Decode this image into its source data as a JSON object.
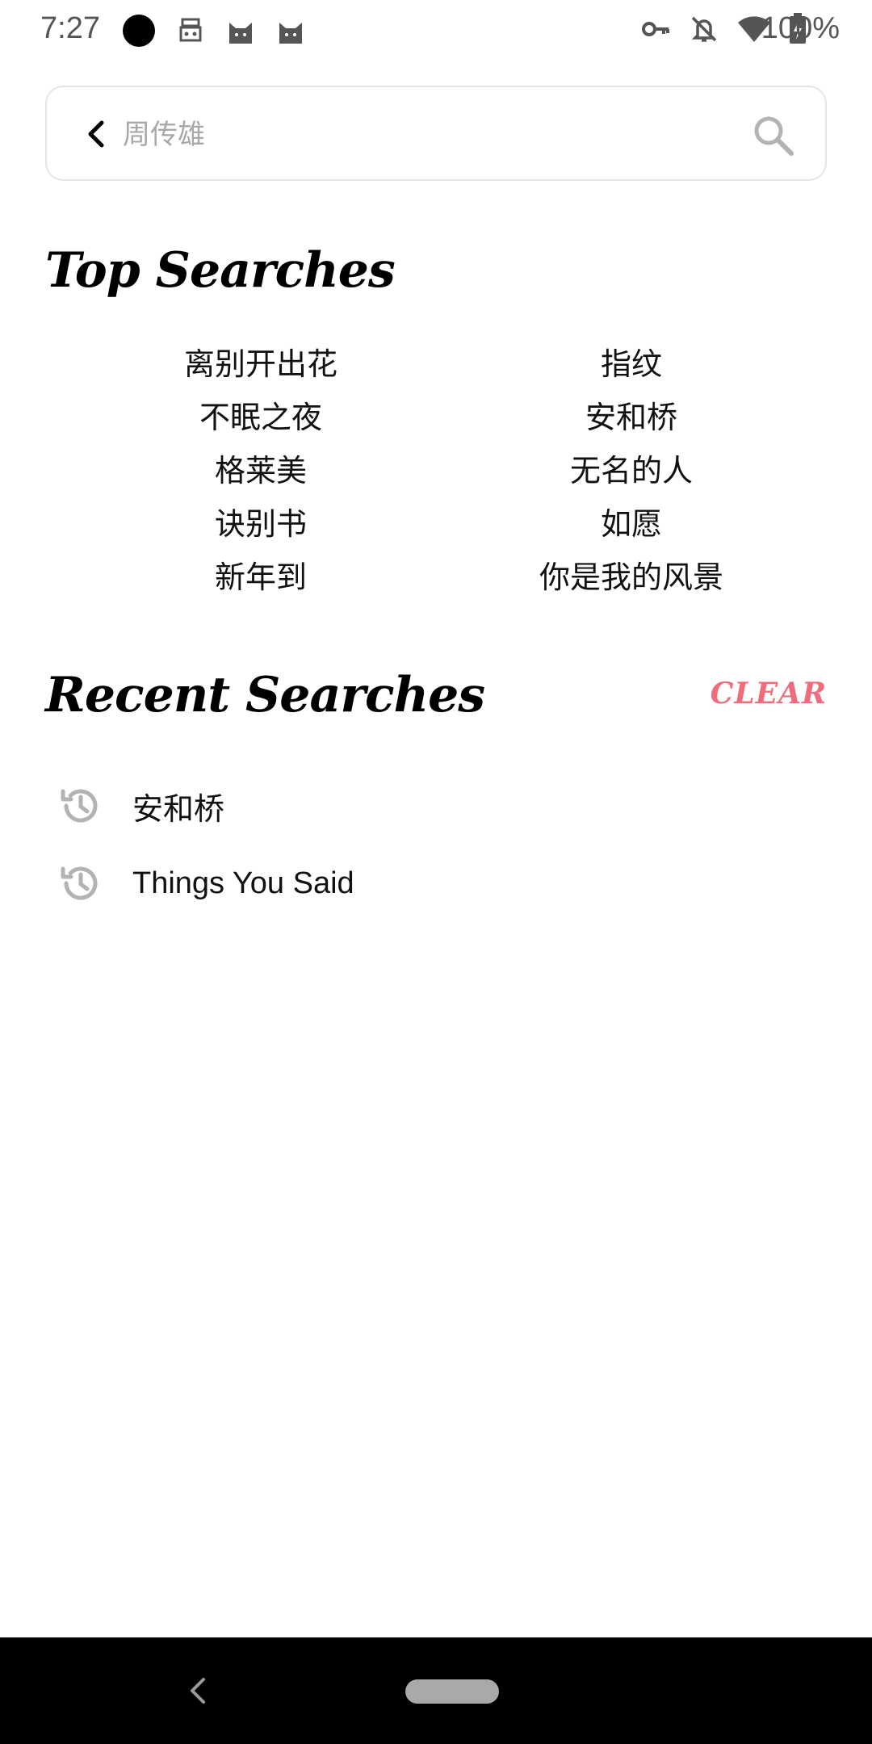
{
  "status_bar": {
    "time": "7:27",
    "battery": "100%",
    "left_icons": [
      "circle-icon",
      "robot-icon",
      "cat-icon",
      "cat-icon"
    ],
    "right_icons": [
      "key-icon",
      "bell-off-icon",
      "wifi-icon",
      "battery-charging-icon"
    ]
  },
  "search": {
    "placeholder": "周传雄",
    "value": ""
  },
  "top_searches": {
    "title": "Top Searches",
    "items": [
      "离别开出花",
      "指纹",
      "不眠之夜",
      "安和桥",
      "格莱美",
      "无名的人",
      "诀别书",
      "如愿",
      "新年到",
      "你是我的风景"
    ]
  },
  "recent_searches": {
    "title": "Recent Searches",
    "clear_label": "CLEAR",
    "items": [
      "安和桥",
      "Things You Said"
    ]
  },
  "colors": {
    "accent": "#f06b7b",
    "placeholder": "#a8a8a8",
    "nav_bar": "#000000"
  }
}
